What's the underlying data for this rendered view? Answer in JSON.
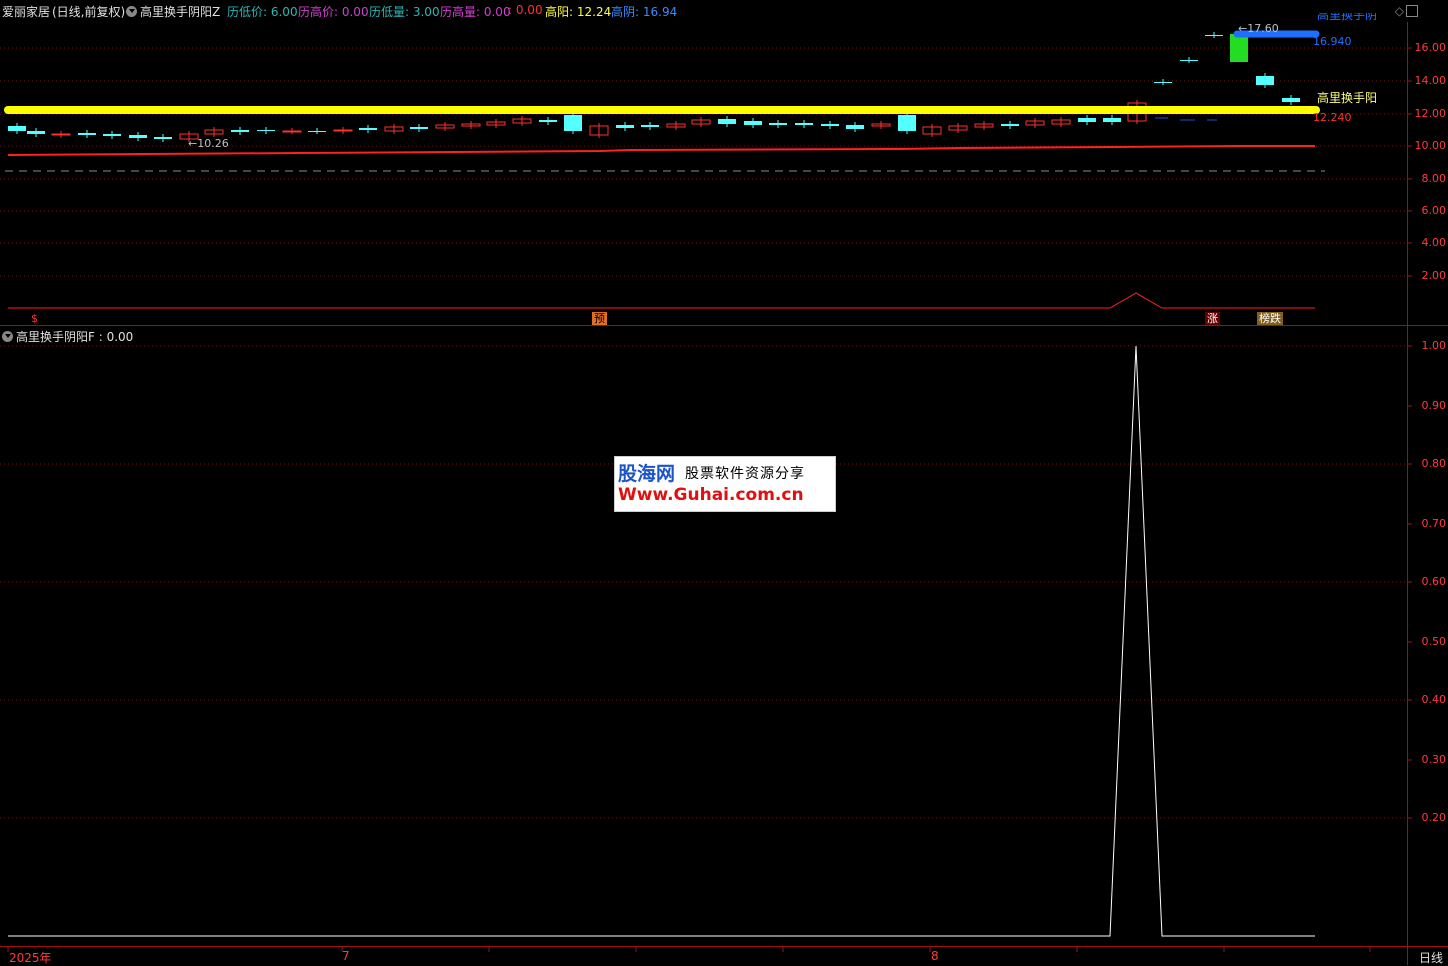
{
  "header": {
    "stock_name": "爱丽家居",
    "period_info": "(日线,前复权)",
    "indicator_name": "高里换手阴阳Z",
    "items": [
      {
        "label": "历低价:",
        "value": "6.00",
        "color": "#2fb5b5"
      },
      {
        "label": "历高价:",
        "value": "0.00",
        "color": "#d040d0"
      },
      {
        "label": "历低量:",
        "value": "3.00",
        "color": "#2fb5b5"
      },
      {
        "label": "历高量:",
        "value": "0.00",
        "color": "#d040d0"
      },
      {
        "label": ":",
        "value": "0.00",
        "color": "#ff3030"
      },
      {
        "label": "高阳:",
        "value": "12.24",
        "color": "#ffff40"
      },
      {
        "label": "高阴:",
        "value": "16.94",
        "color": "#3a8cff"
      }
    ]
  },
  "main_chart": {
    "y_axis_labels": [
      "16.00",
      "14.00",
      "12.00",
      "10.00",
      "8.00",
      "6.00",
      "4.00",
      "2.00"
    ],
    "price_label_low": "10.26",
    "price_label_high": "17.60",
    "yellow_line_label": "高里换手阳",
    "yellow_line_value": "12.240",
    "blue_line_value": "16.940",
    "blue_line_label": "高里换手阴",
    "signal_tags": [
      {
        "text": "$",
        "color": "#ff3030",
        "bg": "#000"
      },
      {
        "text": "预",
        "color": "#000",
        "bg": "#e07020"
      },
      {
        "text": "涨",
        "color": "#ffffff",
        "bg": "#600"
      },
      {
        "text": "榜跌",
        "color": "#fff",
        "bg": "#806020"
      }
    ],
    "colors": {
      "up": "#ff3030",
      "down": "#54ffff",
      "yellow": "#ffff00",
      "blue": "#1f6fff",
      "ma": "#ff2020"
    }
  },
  "sub_chart": {
    "title": "高里换手阴阳F",
    "value": ": 0.00",
    "y_axis_labels": [
      "1.00",
      "0.90",
      "0.80",
      "0.70",
      "0.60",
      "0.50",
      "0.40",
      "0.30",
      "0.20"
    ]
  },
  "bottom_axis": {
    "labels": [
      "2025年",
      "7",
      "8"
    ],
    "period": "日线"
  },
  "watermark": {
    "brand": "股海网",
    "slogan": "股票软件资源分享",
    "url": "Www.Guhai.com.cn"
  }
}
